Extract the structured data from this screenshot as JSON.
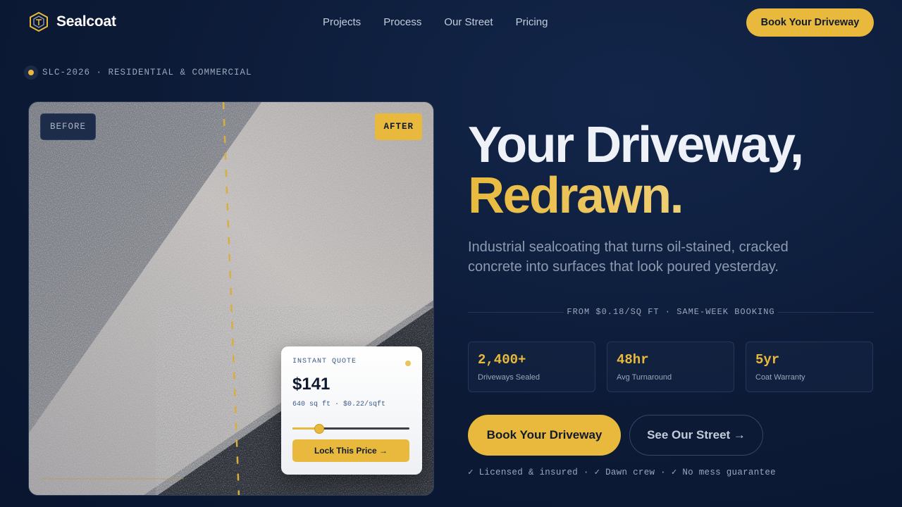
{
  "brand": {
    "name": "Sealcoat",
    "accent": "#e8b93c",
    "background": "#0c1a36"
  },
  "nav": {
    "links": [
      "Projects",
      "Process",
      "Our Street",
      "Pricing"
    ],
    "cta_label": "Book Your Driveway"
  },
  "tagline": "SLC-2026 · RESIDENTIAL & COMMERCIAL",
  "photo": {
    "before_label": "BEFORE",
    "after_label": "AFTER",
    "quote": {
      "label": "INSTANT QUOTE",
      "price": "$141",
      "detail": "640 sq ft · $0.22/sqft",
      "slider_fraction": 0.23,
      "button_label": "Lock This Price →"
    }
  },
  "hero": {
    "title_line1": "Your Driveway,",
    "title_line2": "Redrawn.",
    "subtitle": "Industrial sealcoating that turns oil-stained, cracked concrete into surfaces that look poured yesterday.",
    "divider_text": "FROM $0.18/SQ FT · SAME-WEEK BOOKING"
  },
  "stats": [
    {
      "value": "2,400+",
      "label": "Driveways Sealed"
    },
    {
      "value": "48hr",
      "label": "Avg Turnaround"
    },
    {
      "value": "5yr",
      "label": "Coat Warranty"
    }
  ],
  "actions": {
    "primary_label": "Book Your Driveway",
    "secondary_label": "See Our Street →"
  },
  "assurance": "✓ Licensed & insured · ✓ Dawn crew · ✓ No mess guarantee"
}
